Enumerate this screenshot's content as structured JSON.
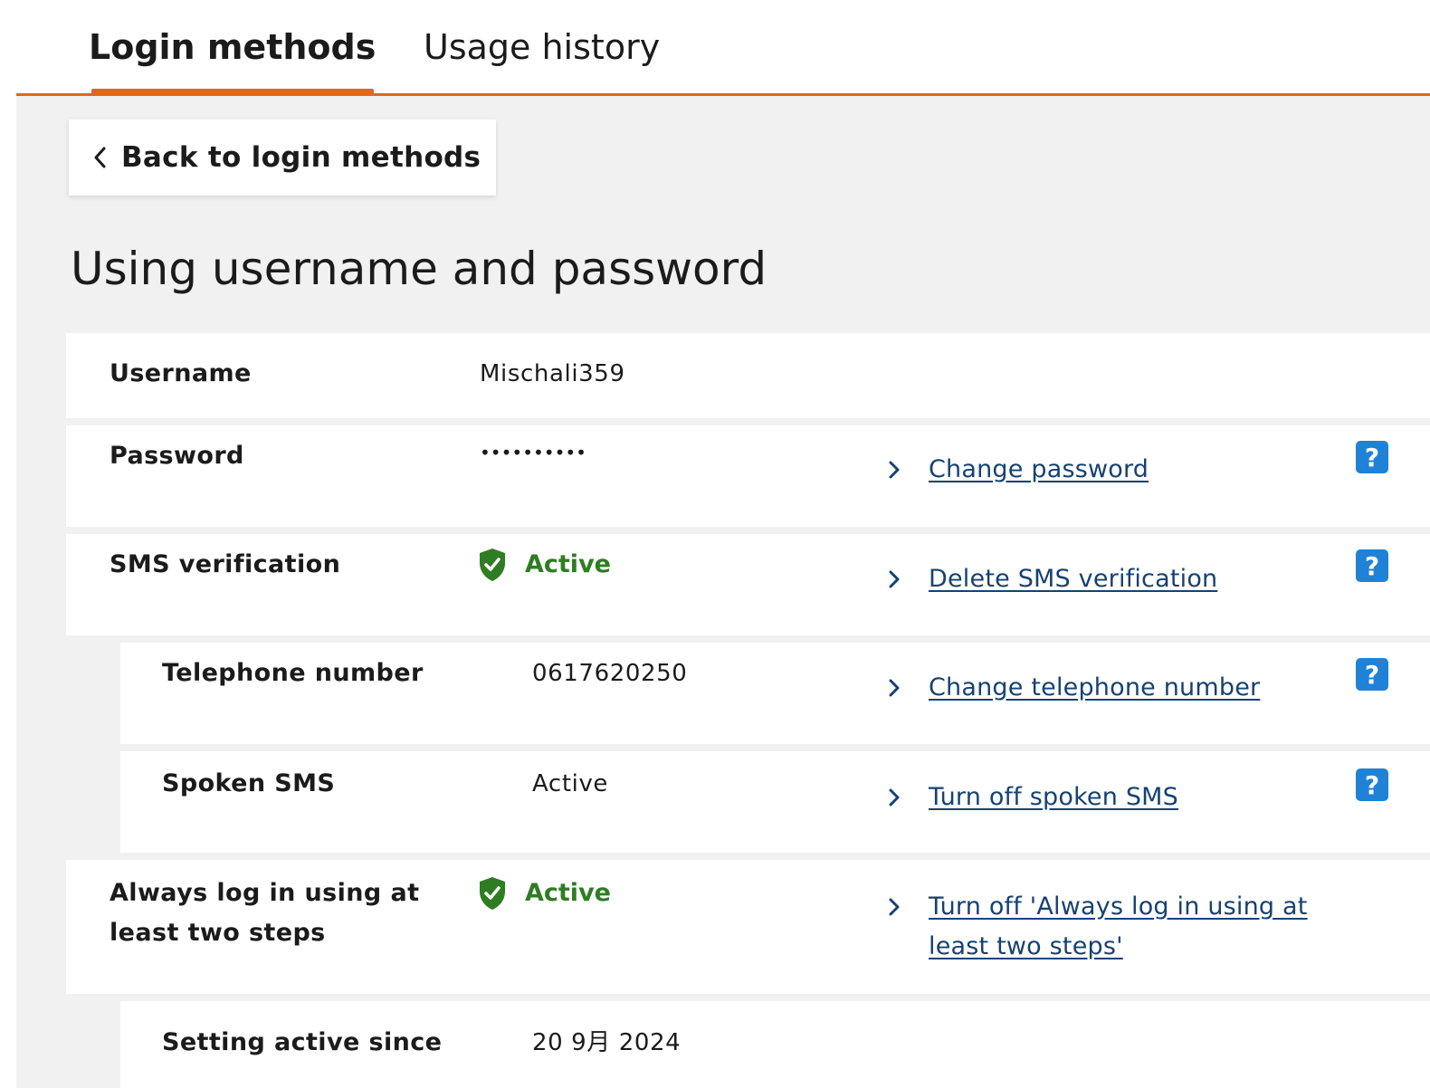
{
  "tabs": [
    {
      "label": "Login methods",
      "active": true
    },
    {
      "label": "Usage history",
      "active": false
    }
  ],
  "back_button": {
    "label": "Back to login methods"
  },
  "page_title": "Using username and password",
  "rows": {
    "username": {
      "label": "Username",
      "value": "Mischali359"
    },
    "password": {
      "label": "Password",
      "value": "••••••••••",
      "action": "Change password"
    },
    "sms": {
      "label": "SMS verification",
      "status": "Active",
      "action": "Delete SMS verification"
    },
    "telephone": {
      "label": "Telephone number",
      "value": "0617620250",
      "action": "Change telephone number"
    },
    "spoken": {
      "label": "Spoken SMS",
      "value": "Active",
      "action": "Turn off spoken SMS"
    },
    "always": {
      "label": "Always log in using at least two steps",
      "status": "Active",
      "action": "Turn off 'Always log in using at least two steps'"
    },
    "since": {
      "label": "Setting active since",
      "value": "20 9月 2024"
    }
  },
  "help_label": "?",
  "colors": {
    "accent_orange": "#e8641b",
    "link_blue": "#154273",
    "status_green": "#2e7d22",
    "help_blue": "#1f82d6",
    "panel_gray": "#f1f1f1"
  },
  "icons": {
    "back": "chevron-left-icon",
    "action": "chevron-right-icon",
    "status": "shield-check-icon",
    "help": "help-icon"
  }
}
